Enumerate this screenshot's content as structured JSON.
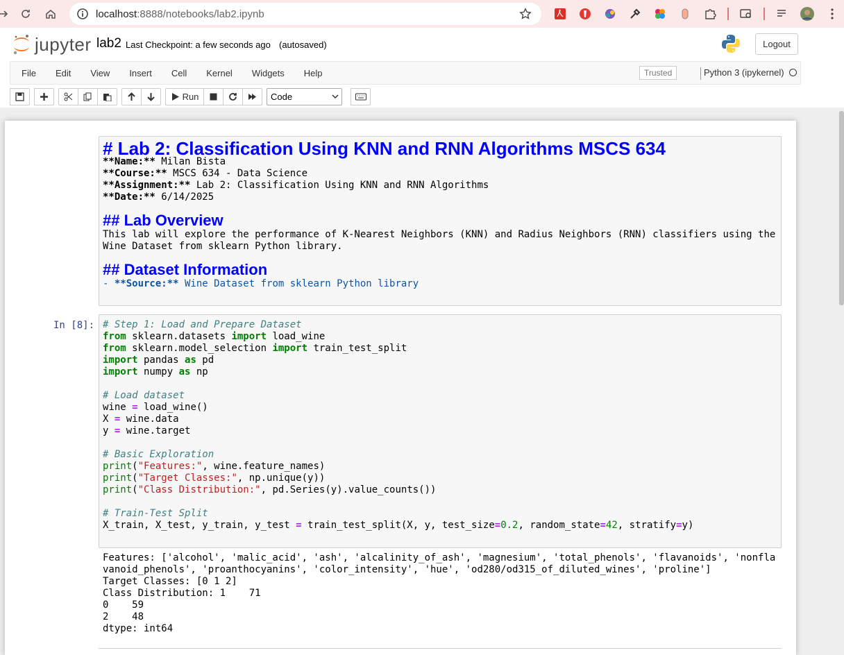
{
  "browser": {
    "url_host": "localhost",
    "url_path": ":8888/notebooks/lab2.ipynb"
  },
  "header": {
    "logo_text": "jupyter",
    "notebook_name": "lab2",
    "checkpoint": "Last Checkpoint: a few seconds ago",
    "autosave": "(autosaved)",
    "logout_label": "Logout"
  },
  "menu": {
    "items": [
      "File",
      "Edit",
      "View",
      "Insert",
      "Cell",
      "Kernel",
      "Widgets",
      "Help"
    ],
    "trusted": "Trusted",
    "kernel": "Python 3 (ipykernel)"
  },
  "toolbar": {
    "run_label": "Run",
    "cell_type": "Code"
  },
  "markdown_cell": {
    "title": "# Lab 2: Classification Using KNN and RNN Algorithms MSCS 634",
    "name_label": "**Name:**",
    "name_value": " Milan Bista",
    "course_label": "**Course:**",
    "course_value": " MSCS 634 - Data Science",
    "assignment_label": "**Assignment:**",
    "assignment_value": " Lab 2: Classification Using KNN and RNN Algorithms",
    "date_label": "**Date:**",
    "date_value": " 6/14/2025",
    "overview_heading": "## Lab Overview",
    "overview_line1": "This lab will explore the performance of K-Nearest Neighbors (KNN) and Radius Neighbors (RNN) classifiers using the",
    "overview_line2": "Wine Dataset from sklearn Python library.",
    "dataset_heading": "## Dataset Information",
    "dataset_source_prefix": "- ",
    "dataset_source_label": "**Source:**",
    "dataset_source_value": " Wine Dataset from sklearn Python library"
  },
  "code_cell": {
    "prompt": "In [8]:",
    "c1": "# Step 1: Load and Prepare Dataset",
    "c2": "# Load dataset",
    "c3": "# Basic Exploration",
    "c4": "# Train-Test Split",
    "str_features": "\"Features:\"",
    "str_target": "\"Target Classes:\"",
    "str_dist": "\"Class Distribution:\""
  },
  "output": {
    "lines": [
      "Features: ['alcohol', 'malic_acid', 'ash', 'alcalinity_of_ash', 'magnesium', 'total_phenols', 'flavanoids', 'nonfla",
      "vanoid_phenols', 'proanthocyanins', 'color_intensity', 'hue', 'od280/od315_of_diluted_wines', 'proline']",
      "Target Classes: [0 1 2]",
      "Class Distribution: 1    71",
      "0    59",
      "2    48",
      "dtype: int64"
    ]
  }
}
